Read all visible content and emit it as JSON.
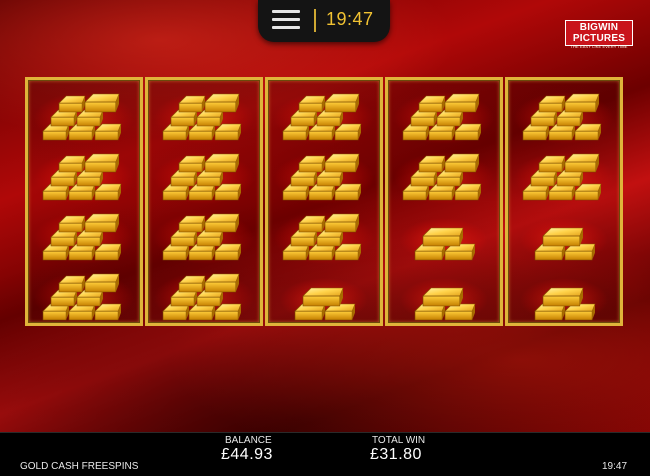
{
  "header": {
    "clock": "19:47"
  },
  "logo": {
    "line1": "BIGWIN PICTURES",
    "line2": "THE EASY LIKE EVERY TIME"
  },
  "reels": [
    [
      "gold-stack-large",
      "gold-stack-large",
      "gold-stack-large",
      "gold-stack-large"
    ],
    [
      "gold-stack-large",
      "gold-stack-large",
      "gold-stack-large",
      "gold-stack-large"
    ],
    [
      "gold-stack-large",
      "gold-stack-large",
      "gold-stack-large",
      "gold-stack-small"
    ],
    [
      "gold-stack-large",
      "gold-stack-large",
      "gold-stack-small",
      "gold-stack-small"
    ],
    [
      "gold-stack-large",
      "gold-stack-large",
      "gold-stack-small",
      "gold-stack-small"
    ]
  ],
  "footer": {
    "balance_label": "BALANCE",
    "balance_value": "£44.93",
    "total_win_label": "TOTAL WIN",
    "total_win_value": "£31.80",
    "game_name": "GOLD CASH FREESPINS",
    "clock": "19:47"
  },
  "colors": {
    "reel_frame": "#e0b43a",
    "clock_accent": "#f1c232",
    "logo_red": "#c9141b"
  }
}
